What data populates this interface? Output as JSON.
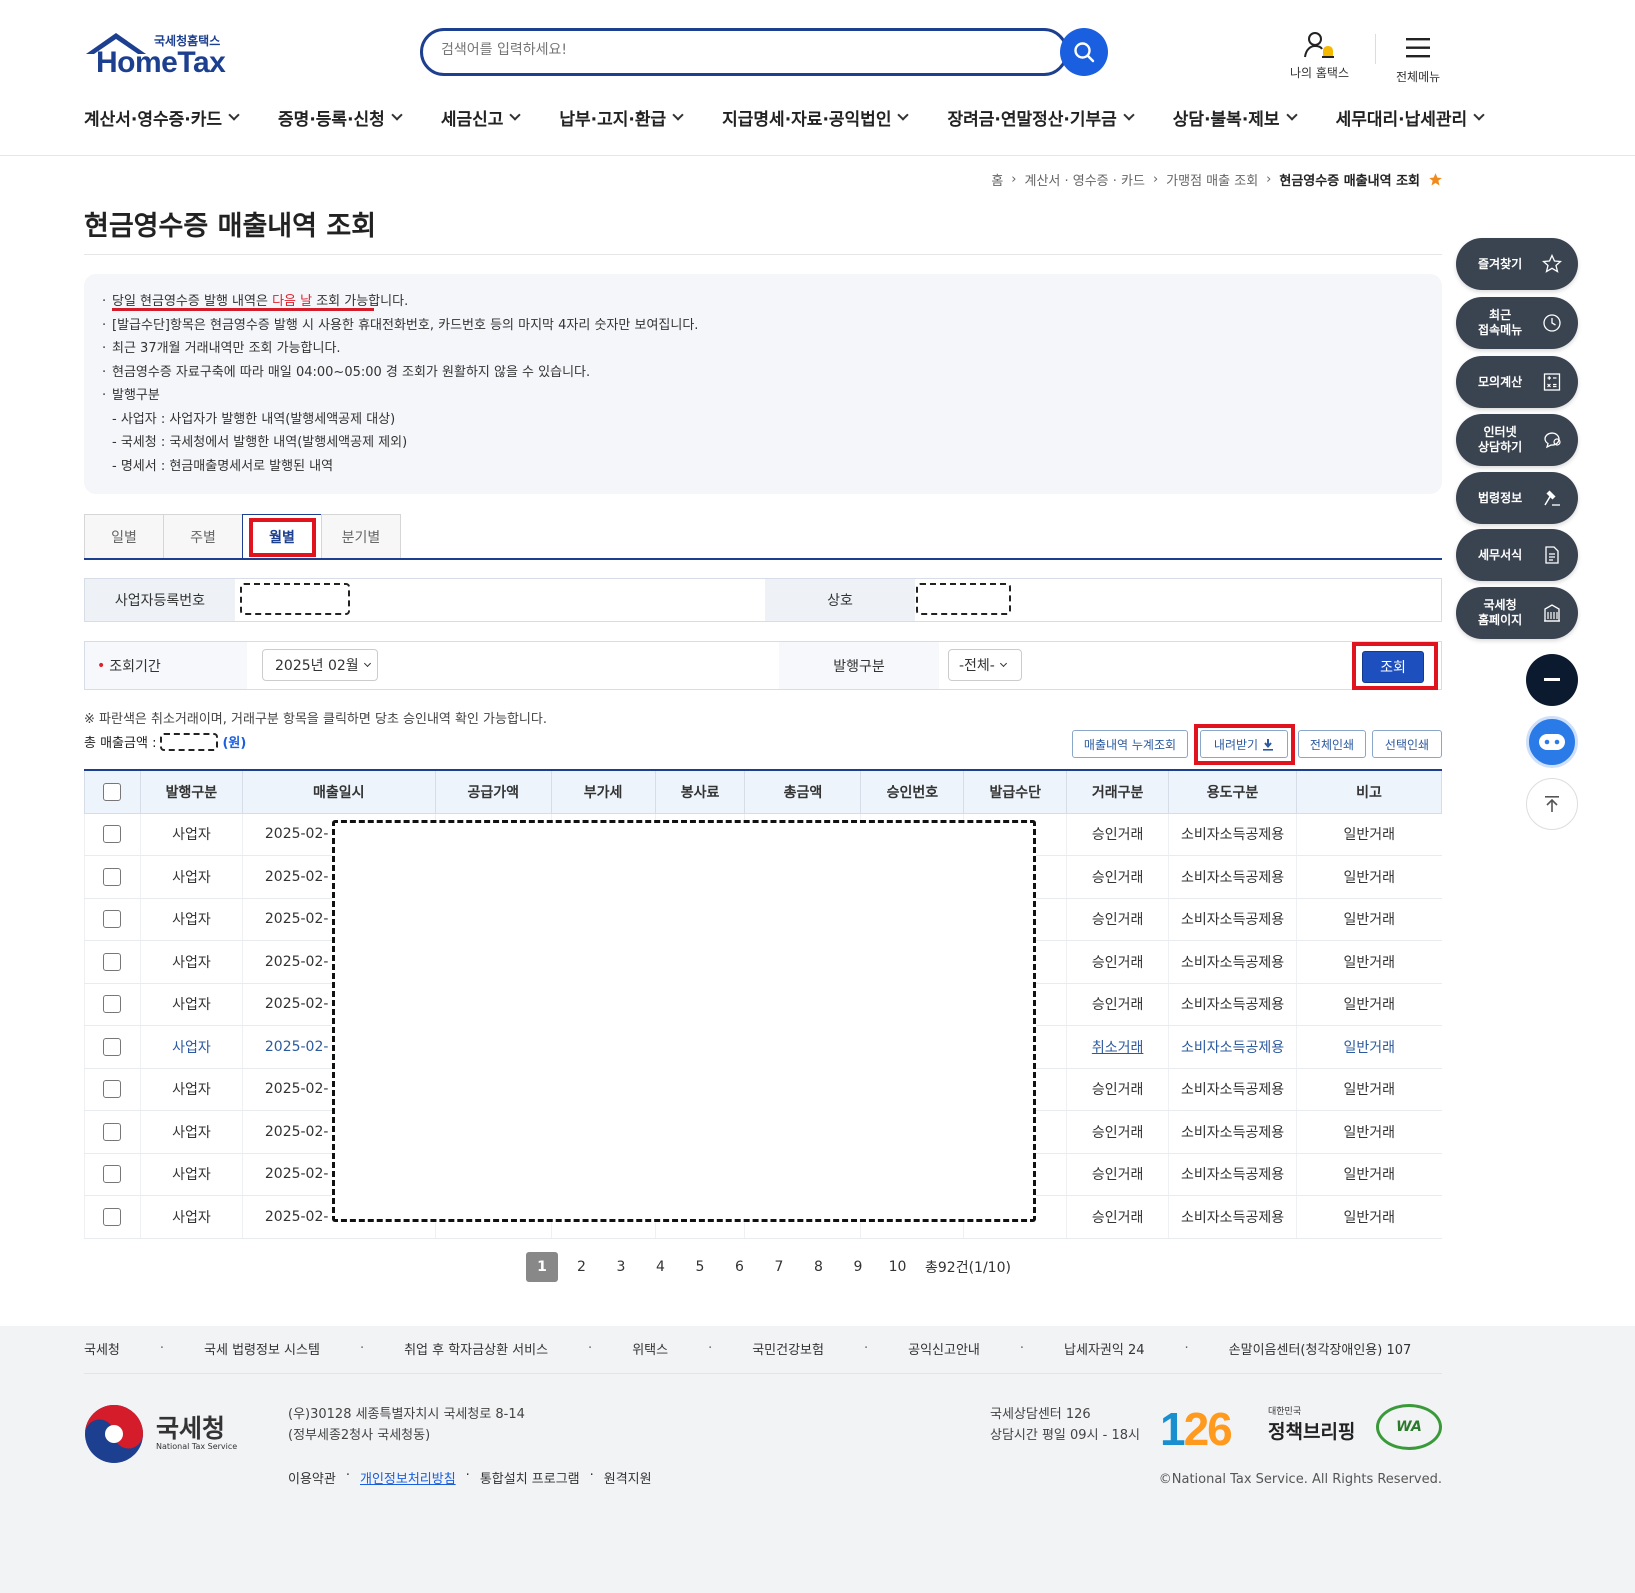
{
  "header": {
    "logo_sub": "국세청홈택스",
    "logo_brand": "HomeTax",
    "search_placeholder": "검색어를 입력하세요!",
    "my_hometax": "나의 홈택스",
    "all_menu": "전체메뉴"
  },
  "gnb": [
    "계산서·영수증·카드",
    "증명·등록·신청",
    "세금신고",
    "납부·고지·환급",
    "지급명세·자료·공익법인",
    "장려금·연말정산·기부금",
    "상담·불복·제보",
    "세무대리·납세관리"
  ],
  "breadcrumb": {
    "home": "홈",
    "level1": "계산서 · 영수증 · 카드",
    "level2": "가맹점 매출 조회",
    "current": "현금영수증 매출내역 조회"
  },
  "page_title": "현금영수증 매출내역 조회",
  "notice": {
    "line1_a": "당일 현금영수증 발행 내역은 ",
    "line1_red": "다음 날",
    "line1_b": " 조회 가능합니다.",
    "line2": "[발급수단]항목은 현금영수증 발행 시 사용한 휴대전화번호, 카드번호 등의 마지막 4자리 숫자만 보여집니다.",
    "line3": "최근 37개월 거래내역만 조회 가능합니다.",
    "line4": "현금영수증 자료구축에 따라 매일 04:00~05:00 경 조회가 원활하지 않을 수 있습니다.",
    "line5": "발행구분",
    "sub1": "- 사업자 : 사업자가 발행한 내역(발행세액공제 대상)",
    "sub2": "- 국세청 : 국세청에서 발행한 내역(발행세액공제 제외)",
    "sub3": "- 명세서 : 현금매출명세서로 발행된 내역"
  },
  "tabs": [
    "일별",
    "주별",
    "월별",
    "분기별"
  ],
  "active_tab": "월별",
  "form": {
    "biz_no_label": "사업자등록번호",
    "company_label": "상호",
    "period_label": "조회기간",
    "period_required": "•",
    "period_value": "2025년 02월",
    "issue_type_label": "발행구분",
    "issue_type_value": "-전체-",
    "query_button": "조회"
  },
  "info_line": "※ 파란색은 취소거래이며, 거래구분 항목을 클릭하면 당초 승인내역 확인 가능합니다.",
  "total_label": "총 매출금액 :",
  "total_unit": "(원)",
  "actions": {
    "cumulative": "매출내역 누계조회",
    "download": "내려받기",
    "print_all": "전체인쇄",
    "print_selected": "선택인쇄"
  },
  "table": {
    "headers": [
      "발행구분",
      "매출일시",
      "공급가액",
      "부가세",
      "봉사료",
      "총금액",
      "승인번호",
      "발급수단",
      "거래구분",
      "용도구분",
      "비고"
    ],
    "rows": [
      {
        "type": "사업자",
        "date": "2025-02-",
        "trade": "승인거래",
        "usage": "소비자소득공제용",
        "note": "일반거래"
      },
      {
        "type": "사업자",
        "date": "2025-02-",
        "trade": "승인거래",
        "usage": "소비자소득공제용",
        "note": "일반거래"
      },
      {
        "type": "사업자",
        "date": "2025-02-",
        "trade": "승인거래",
        "usage": "소비자소득공제용",
        "note": "일반거래"
      },
      {
        "type": "사업자",
        "date": "2025-02-",
        "trade": "승인거래",
        "usage": "소비자소득공제용",
        "note": "일반거래"
      },
      {
        "type": "사업자",
        "date": "2025-02-",
        "trade": "승인거래",
        "usage": "소비자소득공제용",
        "note": "일반거래"
      },
      {
        "type": "사업자",
        "date": "2025-02-",
        "trade": "취소거래",
        "usage": "소비자소득공제용",
        "note": "일반거래"
      },
      {
        "type": "사업자",
        "date": "2025-02-",
        "trade": "승인거래",
        "usage": "소비자소득공제용",
        "note": "일반거래"
      },
      {
        "type": "사업자",
        "date": "2025-02-",
        "trade": "승인거래",
        "usage": "소비자소득공제용",
        "note": "일반거래"
      },
      {
        "type": "사업자",
        "date": "2025-02-",
        "trade": "승인거래",
        "usage": "소비자소득공제용",
        "note": "일반거래"
      },
      {
        "type": "사업자",
        "date": "2025-02-",
        "trade": "승인거래",
        "usage": "소비자소득공제용",
        "note": "일반거래"
      }
    ]
  },
  "pagination": {
    "pages": [
      "1",
      "2",
      "3",
      "4",
      "5",
      "6",
      "7",
      "8",
      "9",
      "10"
    ],
    "current": "1",
    "total_text": "총92건(1/10)"
  },
  "quick_menu": [
    {
      "label": "즐겨찾기",
      "icon": "star-icon"
    },
    {
      "label": "최근\n접속메뉴",
      "icon": "clock-icon"
    },
    {
      "label": "모의계산",
      "icon": "calculator-icon"
    },
    {
      "label": "인터넷\n상담하기",
      "icon": "chat-icon"
    },
    {
      "label": "법령정보",
      "icon": "gavel-icon"
    },
    {
      "label": "세무서식",
      "icon": "document-icon"
    },
    {
      "label": "국세청\n홈페이지",
      "icon": "building-icon"
    }
  ],
  "footer": {
    "links": [
      "국세청",
      "국세 법령정보 시스템",
      "취업 후 학자금상환 서비스",
      "위택스",
      "국민건강보험",
      "공익신고안내",
      "납세자권익 24",
      "손말이음센터(청각장애인용) 107"
    ],
    "org_name": "국세청",
    "org_eng": "National Tax Service",
    "address1": "(우)30128 세종특별자치시 국세청로 8-14",
    "address2": "(정부세종2청사 국세청동)",
    "terms": "이용약관",
    "privacy": "개인정보처리방침",
    "install": "통합설치 프로그램",
    "remote": "원격지원",
    "consult1": "국세상담센터 126",
    "consult2": "상담시간 평일 09시 - 18시",
    "logo126_a": "1",
    "logo126_b": "26",
    "policy_small": "대한민국",
    "policy_main": "정책브리핑",
    "wa": "WA",
    "copyright": "©National Tax Service. All Rights Reserved."
  },
  "colors": {
    "brand": "#1d3f8f",
    "accent": "#1a5fe0",
    "highlight": "#e0141e"
  }
}
